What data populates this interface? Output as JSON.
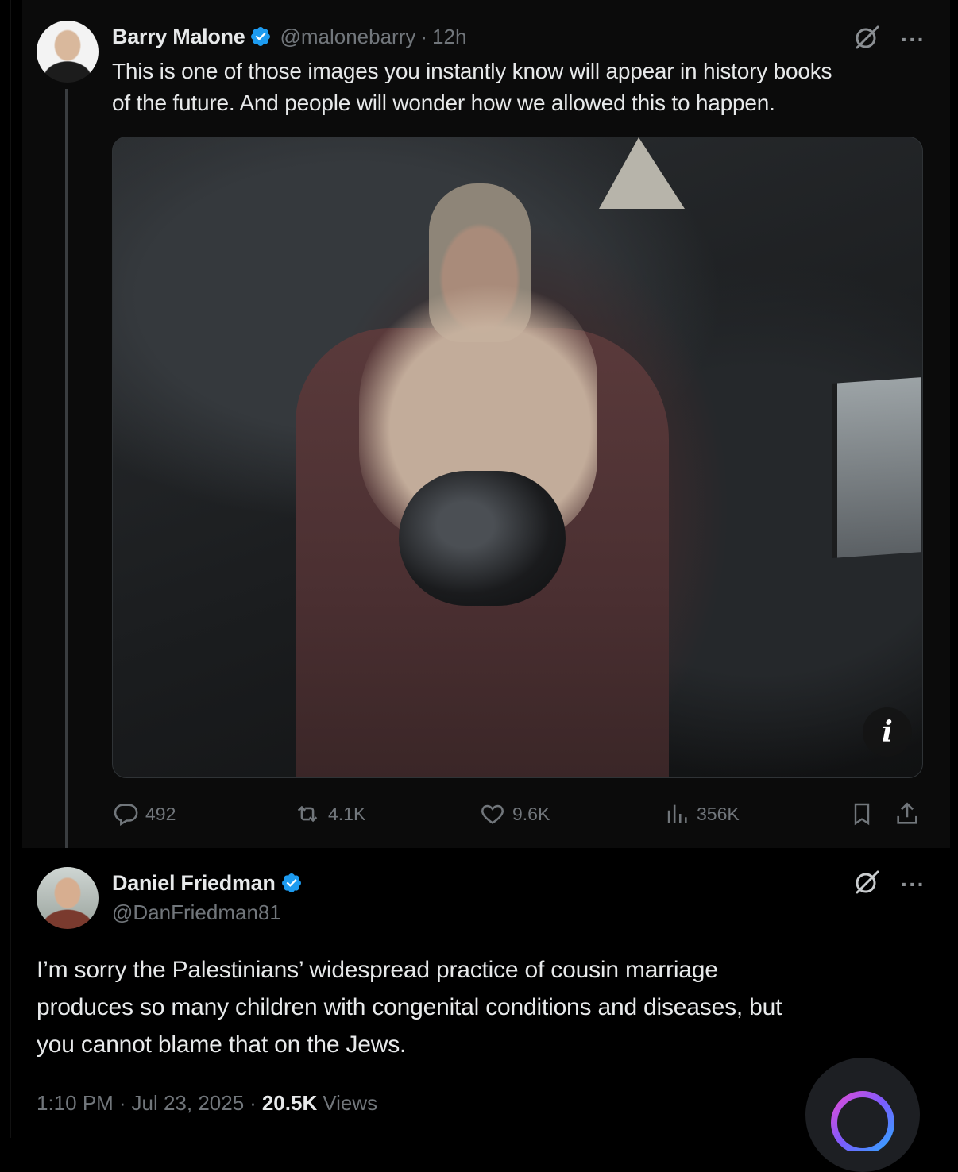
{
  "tweet1": {
    "author_name": "Barry Malone",
    "handle": "@malonebarry",
    "separator": "·",
    "time": "12h",
    "text_line1": "This is one of those images you instantly know will appear in history books",
    "text_line2": "of the future. And people will wonder how we allowed this to happen.",
    "media_info_badge": "i",
    "actions": {
      "replies": "492",
      "reposts": "4.1K",
      "likes": "9.6K",
      "views": "356K"
    },
    "more_label": "···"
  },
  "tweet2": {
    "author_name": "Daniel Friedman",
    "handle": "@DanFriedman81",
    "text_line1": "I’m sorry the Palestinians’ widespread practice of cousin marriage",
    "text_line2": "produces so many children with congenital conditions and diseases, but",
    "text_line3": "you cannot blame that on the Jews.",
    "time": "1:10 PM",
    "date": "Jul 23, 2025",
    "separator": "·",
    "views_count": "20.5K",
    "views_label": "Views",
    "more_label": "···"
  },
  "icons": {
    "verified": "verified-badge-icon",
    "grok": "grok-icon",
    "reply": "reply-icon",
    "repost": "repost-icon",
    "like": "like-icon",
    "views": "views-icon",
    "bookmark": "bookmark-icon",
    "share": "share-icon"
  },
  "colors": {
    "background": "#000000",
    "verified_blue": "#1d9bf0",
    "muted_text": "#71767b",
    "primary_text": "#e7e9ea"
  }
}
